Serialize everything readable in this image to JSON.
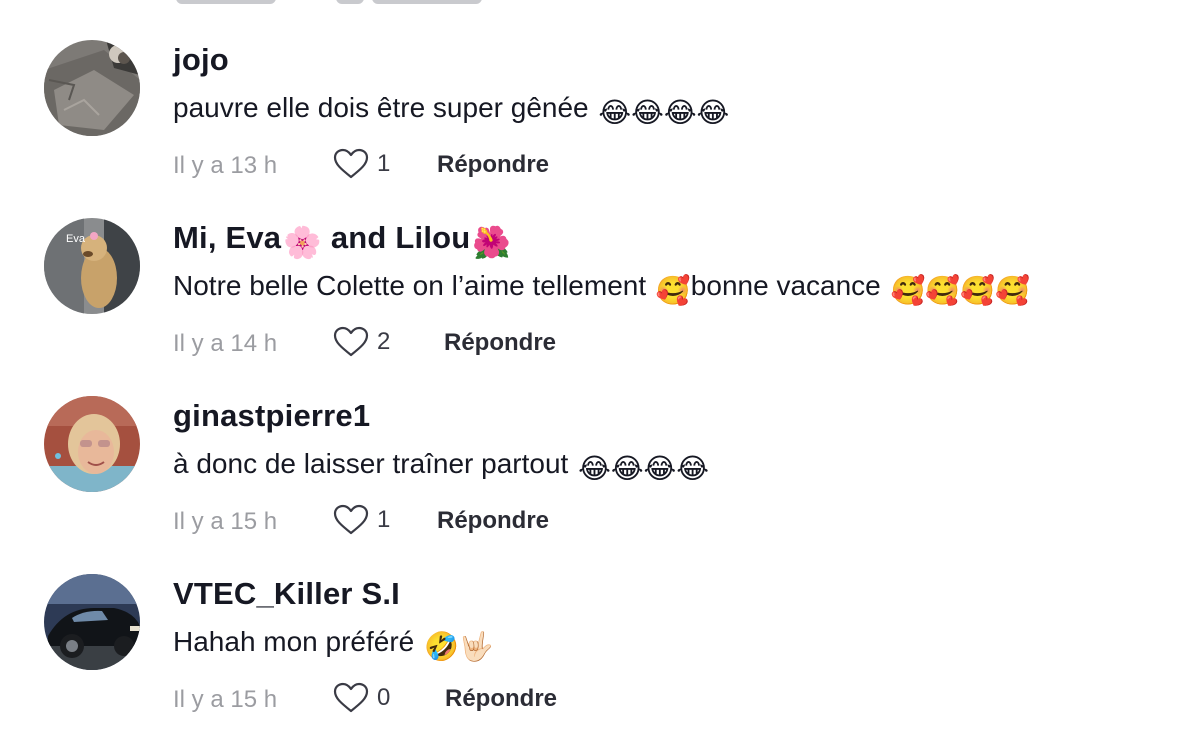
{
  "comments": [
    {
      "username": "jojo",
      "text": "pauvre elle dois être super gênée",
      "text_emojis": "😂😂😂😂",
      "time": "Il y a 13 h",
      "likes": "1",
      "reply_label": "Répondre"
    },
    {
      "username_prefix": "Mi, Eva",
      "username_emoji_1": "🌸",
      "username_middle": " and Lilou",
      "username_emoji_2": "🌺",
      "text": "Notre belle Colette on l’aime tellement",
      "text_emoji_inline": "🥰",
      "text_after": "bonne vacance",
      "text_emojis": "🥰🥰🥰🥰",
      "avatar_overlay_text": "Eva",
      "time": "Il y a 14 h",
      "likes": "2",
      "reply_label": "Répondre"
    },
    {
      "username": "ginastpierre1",
      "text": "à donc de laisser traîner partout",
      "text_emojis": "😂😂😂😂",
      "time": "Il y a 15 h",
      "likes": "1",
      "reply_label": "Répondre"
    },
    {
      "username": "VTEC_Killer S.I",
      "text": "Hahah mon préféré",
      "text_emojis": "🤣🤟🏻",
      "time": "Il y a 15 h",
      "likes": "0",
      "reply_label": "Répondre"
    }
  ],
  "icons": {
    "like": "heart-outline-icon"
  },
  "colors": {
    "username": "#161823",
    "text": "#161823",
    "timestamp": "#9b9ca1",
    "reply": "#2b2c35",
    "heart_stroke": "#3a3b45"
  }
}
